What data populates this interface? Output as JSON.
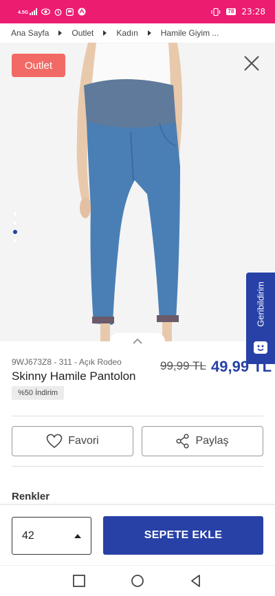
{
  "status_bar": {
    "network": "4.5G",
    "battery": "78",
    "time": "23:28"
  },
  "breadcrumb": [
    "Ana Sayfa",
    "Outlet",
    "Kadın",
    "Hamile Giyim ..."
  ],
  "gallery": {
    "badge": "Outlet",
    "slide_count": 4,
    "active_slide": 3
  },
  "feedback": {
    "label": "Geribildirim"
  },
  "product": {
    "code": "9WJ673Z8 - 311 - Açık Rodeo",
    "title": "Skinny Hamile Pantolon",
    "discount": "%50 İndirim",
    "old_price": "99,99 TL",
    "new_price": "49,99 TL"
  },
  "actions": {
    "favorite": "Favori",
    "share": "Paylaş"
  },
  "colors_heading": "Renkler",
  "bottom_bar": {
    "size": "42",
    "add_to_cart": "SEPETE EKLE"
  },
  "colors": {
    "status_bar": "#ec1c71",
    "accent": "#2741a6",
    "outlet_badge": "#f26a65"
  }
}
